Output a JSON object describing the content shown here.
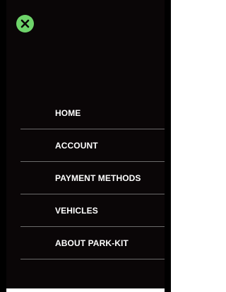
{
  "close": {
    "icon": "close-icon",
    "color": "#6ed36a"
  },
  "menu": {
    "items": [
      {
        "label": "HOME"
      },
      {
        "label": "ACCOUNT"
      },
      {
        "label": "PAYMENT METHODS"
      },
      {
        "label": "VEHICLES"
      },
      {
        "label": "ABOUT PARK-KIT"
      }
    ]
  },
  "colors": {
    "panel_background": "#0a0607",
    "divider": "#6b6b6b",
    "text": "#ffffff"
  }
}
